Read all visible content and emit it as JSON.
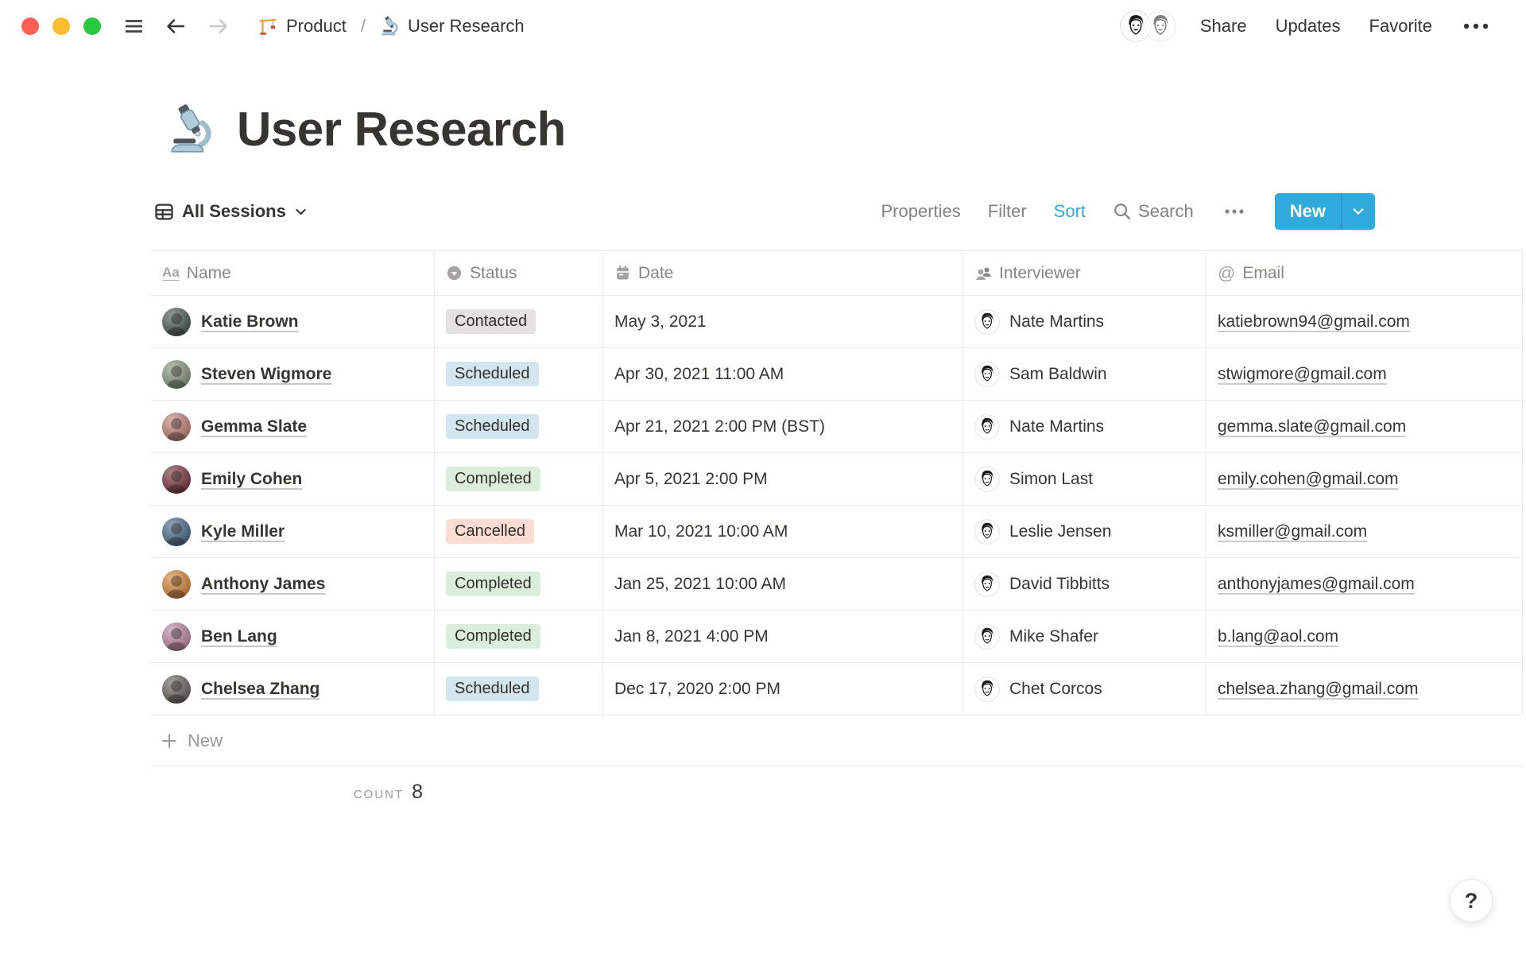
{
  "topbar": {
    "breadcrumb": {
      "parent": "Product",
      "separator": "/",
      "current": "User Research"
    },
    "share_label": "Share",
    "updates_label": "Updates",
    "favorite_label": "Favorite"
  },
  "page": {
    "title": "User Research",
    "icon": "microscope"
  },
  "view_bar": {
    "view_name": "All Sessions",
    "properties_label": "Properties",
    "filter_label": "Filter",
    "sort_label": "Sort",
    "search_label": "Search",
    "new_label": "New",
    "accent_color": "#2EAADC",
    "sort_active_color": "#2EAADC"
  },
  "table": {
    "columns": [
      {
        "label": "Name",
        "icon": "title-icon",
        "glyph": "Aa"
      },
      {
        "label": "Status",
        "icon": "select-icon"
      },
      {
        "label": "Date",
        "icon": "calendar-icon"
      },
      {
        "label": "Interviewer",
        "icon": "person-icon"
      },
      {
        "label": "Email",
        "icon": "email-icon",
        "glyph": "@"
      }
    ],
    "status_colors": {
      "Contacted": "#E3E2E0",
      "Scheduled": "#D3E5EF",
      "Completed": "#DBEDDB",
      "Cancelled": "#FBDDD3"
    },
    "rows": [
      {
        "name": "Katie Brown",
        "avatar_color": "#50605A",
        "status": "Contacted",
        "status_color": "#E3E2E0",
        "date": "May 3, 2021",
        "interviewer": "Nate Martins",
        "email": "katiebrown94@gmail.com"
      },
      {
        "name": "Steven Wigmore",
        "avatar_color": "#8C9B85",
        "status": "Scheduled",
        "status_color": "#D3E5EF",
        "date": "Apr 30, 2021 11:00 AM",
        "interviewer": "Sam Baldwin",
        "email": "stwigmore@gmail.com"
      },
      {
        "name": "Gemma Slate",
        "avatar_color": "#C4857C",
        "status": "Scheduled",
        "status_color": "#D3E5EF",
        "date": "Apr 21, 2021 2:00 PM (BST)",
        "interviewer": "Nate Martins",
        "email": "gemma.slate@gmail.com"
      },
      {
        "name": "Emily Cohen",
        "avatar_color": "#7E3B43",
        "status": "Completed",
        "status_color": "#DBEDDB",
        "date": "Apr 5, 2021 2:00 PM",
        "interviewer": "Simon Last",
        "email": "emily.cohen@gmail.com"
      },
      {
        "name": "Kyle Miller",
        "avatar_color": "#4E6E8E",
        "status": "Cancelled",
        "status_color": "#FBDDD3",
        "date": "Mar 10, 2021 10:00 AM",
        "interviewer": "Leslie Jensen",
        "email": "ksmiller@gmail.com"
      },
      {
        "name": "Anthony James",
        "avatar_color": "#D98A3D",
        "status": "Completed",
        "status_color": "#DBEDDB",
        "date": "Jan 25, 2021 10:00 AM",
        "interviewer": "David Tibbitts",
        "email": "anthonyjames@gmail.com"
      },
      {
        "name": "Ben Lang",
        "avatar_color": "#C08CA6",
        "status": "Completed",
        "status_color": "#DBEDDB",
        "date": "Jan 8, 2021 4:00 PM",
        "interviewer": "Mike Shafer",
        "email": "b.lang@aol.com"
      },
      {
        "name": "Chelsea Zhang",
        "avatar_color": "#6E6862",
        "status": "Scheduled",
        "status_color": "#D3E5EF",
        "date": "Dec 17, 2020 2:00 PM",
        "interviewer": "Chet Corcos",
        "email": "chelsea.zhang@gmail.com"
      }
    ],
    "new_row_label": "New",
    "count_label": "COUNT",
    "count_value": "8"
  },
  "help": {
    "label": "?"
  }
}
